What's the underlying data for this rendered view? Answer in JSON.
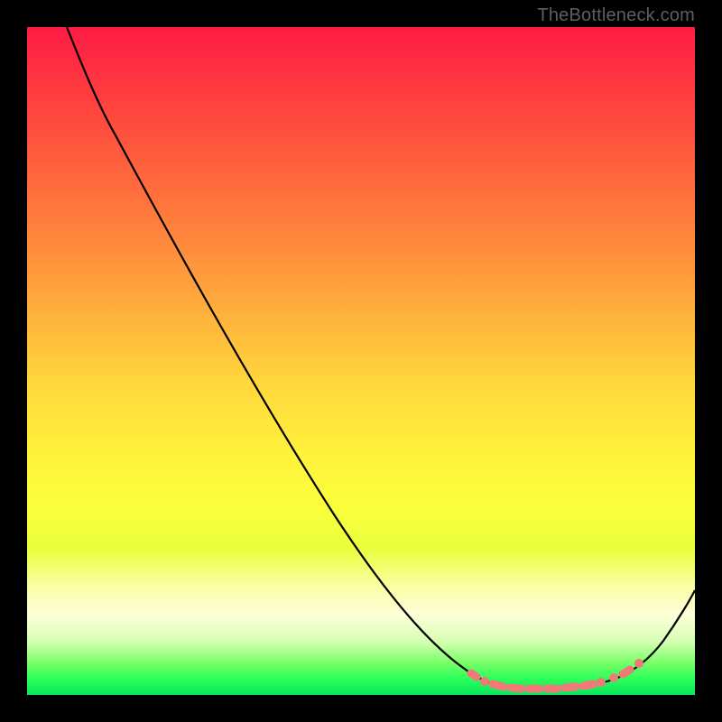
{
  "attribution": "TheBottleneck.com",
  "colors": {
    "marker": "#f07a78",
    "curve": "#000000"
  },
  "chart_data": {
    "type": "line",
    "title": "",
    "xlabel": "",
    "ylabel": "",
    "x_range": [
      0,
      100
    ],
    "y_range": [
      0,
      100
    ],
    "series": [
      {
        "name": "bottleneck-curve",
        "x": [
          0,
          4,
          9,
          14,
          19,
          24,
          28,
          33,
          38,
          43,
          47,
          52,
          57,
          62,
          66,
          69,
          72,
          74,
          76,
          79,
          81,
          84,
          86,
          88,
          91,
          93,
          95,
          97,
          100
        ],
        "y": [
          100,
          97,
          92,
          86,
          80,
          73,
          66,
          60,
          53,
          46,
          40,
          33,
          26,
          19,
          12,
          8,
          5,
          3,
          2,
          1,
          1,
          1,
          1,
          1,
          2,
          4,
          7,
          11,
          17
        ]
      }
    ],
    "highlight_zone": {
      "name": "optimal-range",
      "x_start": 68,
      "x_end": 91,
      "style": "dotted-pink"
    },
    "background_gradient_meaning": "red-high-bottleneck-to-green-low-bottleneck"
  }
}
